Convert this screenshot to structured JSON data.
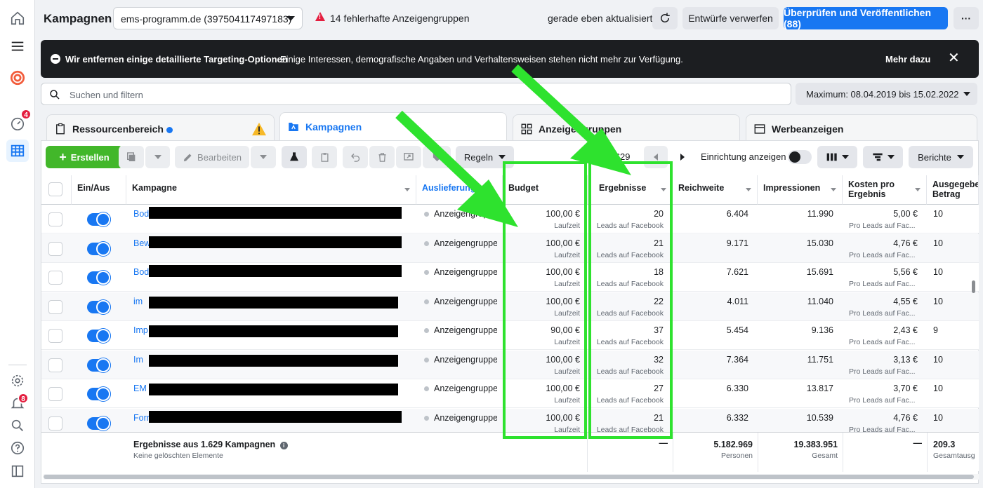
{
  "header": {
    "title": "Kampagnen",
    "account": "ems-programm.de (397504117497183)",
    "errors": "14 fehlerhafte Anzeigengruppen",
    "updated": "gerade eben aktualisiert",
    "discard": "Entwürfe verwerfen",
    "publish": "Überprüfen und Veröffentlichen (88)",
    "more": "···"
  },
  "nav": {
    "badge_dashboard": "4",
    "badge_notifications": "8"
  },
  "banner": {
    "title": "Wir entfernen einige detaillierte Targeting-Optionen",
    "text": "Einige Interessen, demografische Angaben und Verhaltensweisen stehen nicht mehr zur Verfügung.",
    "more": "Mehr dazu",
    "close": "✕"
  },
  "search": {
    "placeholder": "Suchen und filtern",
    "daterange": "Maximum: 08.04.2019 bis 15.02.2022"
  },
  "tabs": {
    "resources": "Ressourcenbereich",
    "campaigns": "Kampagnen",
    "adsets": "Anzeigengruppen",
    "ads": "Werbeanzeigen"
  },
  "toolbar": {
    "create": "Erstellen",
    "edit": "Bearbeiten",
    "rules": "Regeln",
    "pagination": "1-8 von 1.629",
    "setup": "Einrichtung anzeigen",
    "reports": "Berichte"
  },
  "columns": {
    "onoff": "Ein/Aus",
    "campaign": "Kampagne",
    "delivery": "Auslieferung",
    "budget": "Budget",
    "results": "Ergebnisse",
    "reach": "Reichweite",
    "impressions": "Impressionen",
    "cpr": "Kosten pro Ergebnis",
    "spent": "Ausgegebener Betrag"
  },
  "rows": [
    {
      "name": "Bod",
      "status": "Anzeigengruppen",
      "budget": "100,00 €",
      "budget_sub": "Laufzeit",
      "results": "20",
      "results_sub": "Leads auf Facebook",
      "reach": "6.404",
      "impressions": "11.990",
      "cpr": "5,00 €",
      "cpr_sub": "Pro Leads auf Fac...",
      "spent": "10"
    },
    {
      "name": "Bew",
      "status": "Anzeigengruppen",
      "budget": "100,00 €",
      "budget_sub": "Laufzeit",
      "results": "21",
      "results_sub": "Leads auf Facebook",
      "reach": "9.171",
      "impressions": "15.030",
      "cpr": "4,76 €",
      "cpr_sub": "Pro Leads auf Fac...",
      "spent": "10"
    },
    {
      "name": "Bod",
      "status": "Anzeigengruppen",
      "budget": "100,00 €",
      "budget_sub": "Laufzeit",
      "results": "18",
      "results_sub": "Leads auf Facebook",
      "reach": "7.621",
      "impressions": "15.691",
      "cpr": "5,56 €",
      "cpr_sub": "Pro Leads auf Fac...",
      "spent": "10"
    },
    {
      "name": "im",
      "status": "Anzeigengruppen",
      "budget": "100,00 €",
      "budget_sub": "Laufzeit",
      "results": "22",
      "results_sub": "Leads auf Facebook",
      "reach": "4.011",
      "impressions": "11.040",
      "cpr": "4,55 €",
      "cpr_sub": "Pro Leads auf Fac...",
      "spent": "10"
    },
    {
      "name": "Imp",
      "status": "Anzeigengruppen",
      "budget": "90,00 €",
      "budget_sub": "Laufzeit",
      "results": "37",
      "results_sub": "Leads auf Facebook",
      "reach": "5.454",
      "impressions": "9.136",
      "cpr": "2,43 €",
      "cpr_sub": "Pro Leads auf Fac...",
      "spent": "9"
    },
    {
      "name": "Im",
      "status": "Anzeigengruppen",
      "budget": "100,00 €",
      "budget_sub": "Laufzeit",
      "results": "32",
      "results_sub": "Leads auf Facebook",
      "reach": "7.364",
      "impressions": "11.751",
      "cpr": "3,13 €",
      "cpr_sub": "Pro Leads auf Fac...",
      "spent": "10"
    },
    {
      "name": "EM",
      "status": "Anzeigengruppen",
      "budget": "100,00 €",
      "budget_sub": "Laufzeit",
      "results": "27",
      "results_sub": "Leads auf Facebook",
      "reach": "6.330",
      "impressions": "13.817",
      "cpr": "3,70 €",
      "cpr_sub": "Pro Leads auf Fac...",
      "spent": "10"
    },
    {
      "name": "Forr",
      "status": "Anzeigengruppen",
      "budget": "100,00 €",
      "budget_sub": "Laufzeit",
      "results": "21",
      "results_sub": "Leads auf Facebook",
      "reach": "6.332",
      "impressions": "10.539",
      "cpr": "4,76 €",
      "cpr_sub": "Pro Leads auf Fac...",
      "spent": "10"
    }
  ],
  "totals": {
    "title": "Ergebnisse aus 1.629 Kampagnen",
    "sub": "Keine gelöschten Elemente",
    "results": "—",
    "reach": "5.182.969",
    "reach_sub": "Personen",
    "impressions": "19.383.951",
    "impressions_sub": "Gesamt",
    "cpr": "—",
    "spent": "209.3",
    "spent_sub": "Gesamtausg"
  },
  "colors": {
    "accent": "#1877f2",
    "highlight": "#2ee22e",
    "create": "#42b72a"
  }
}
